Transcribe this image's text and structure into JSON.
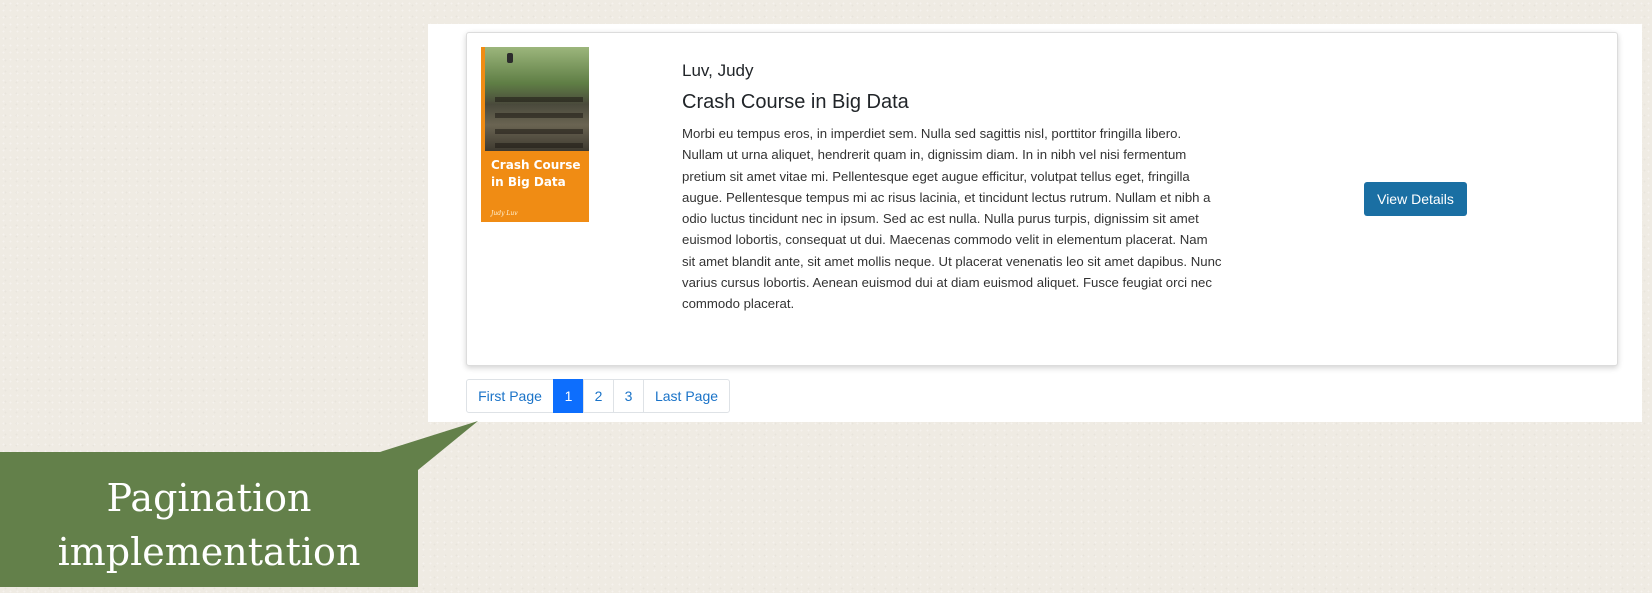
{
  "book": {
    "author": "Luv, Judy",
    "title": "Crash Course in Big Data",
    "description": "Morbi eu tempus eros, in imperdiet sem. Nulla sed sagittis nisl, porttitor fringilla libero. Nullam ut urna aliquet, hendrerit quam in, dignissim diam. In in nibh vel nisi fermentum pretium sit amet vitae mi. Pellentesque eget augue efficitur, volutpat tellus eget, fringilla augue. Pellentesque tempus mi ac risus lacinia, et tincidunt lectus rutrum. Nullam et nibh a odio luctus tincidunt nec in ipsum. Sed ac est nulla. Nulla purus turpis, dignissim sit amet euismod lobortis, consequat ut dui. Maecenas commodo velit in elementum placerat. Nam sit amet blandit ante, sit amet mollis neque. Ut placerat venenatis leo sit amet dapibus. Nunc varius cursus lobortis. Aenean euismod dui at diam euismod aliquet. Fusce feugiat orci nec commodo placerat.",
    "cover": {
      "title": "Crash Course in Big Data",
      "author": "Judy Luv",
      "color": "#f08c14"
    },
    "details_label": "View Details"
  },
  "pagination": {
    "first_label": "First Page",
    "pages": [
      "1",
      "2",
      "3"
    ],
    "active_page": "1",
    "last_label": "Last Page"
  },
  "callout": {
    "line1": "Pagination",
    "line2": "implementation",
    "color": "#63804a"
  },
  "colors": {
    "button": "#1a6fa3",
    "active_page": "#0d6efd",
    "link": "#1a73c8"
  }
}
